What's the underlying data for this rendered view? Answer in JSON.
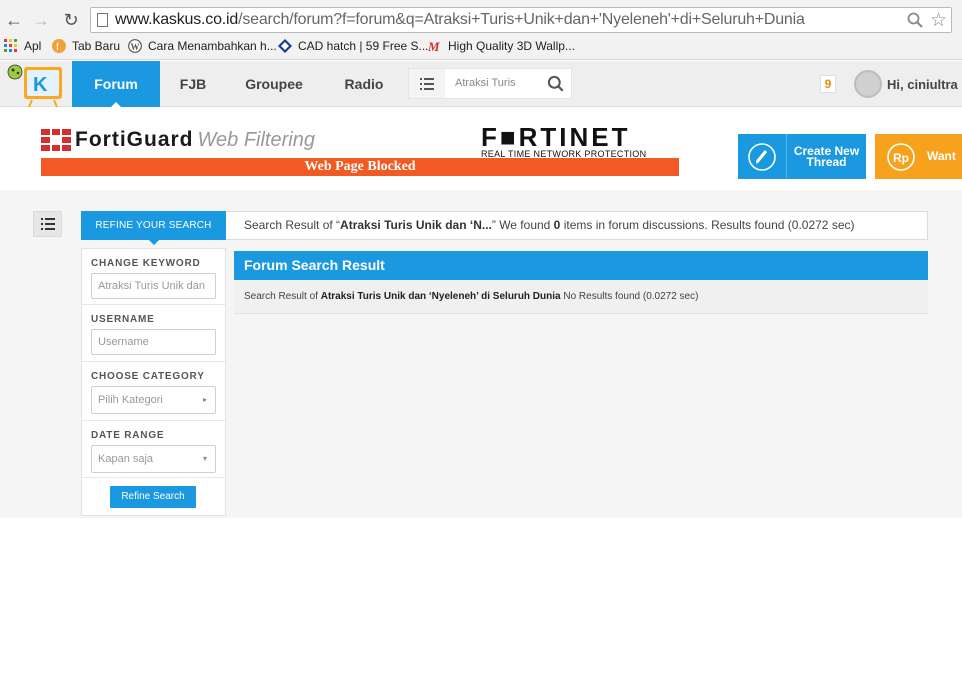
{
  "browser": {
    "url_host": "www.kaskus.co.id",
    "url_path": "/search/forum?f=forum&q=Atraksi+Turis+Unik+dan+'Nyeleneh'+di+Seluruh+Dunia",
    "bookmarks": [
      {
        "label": "Apl",
        "icon": "apps-icon"
      },
      {
        "label": "Tab Baru",
        "icon": "tab-icon"
      },
      {
        "label": "Cara Menambahkan h...",
        "icon": "wordpress-icon"
      },
      {
        "label": "CAD hatch | 59 Free S...",
        "icon": "cad-icon"
      },
      {
        "label": "High Quality 3D Wallp...",
        "icon": "gmail-icon"
      }
    ]
  },
  "header": {
    "nav": [
      "Forum",
      "FJB",
      "Groupee",
      "Radio"
    ],
    "active_nav": "Forum",
    "search_value": "Atraksi Turis",
    "notif_count": "9",
    "greeting": "Hi, ciniultra"
  },
  "banner": {
    "fortiguard": "FortiGuard",
    "web_filtering": "Web Filtering",
    "fortinet": "F■RTINET",
    "fortinet_sub": "REAL TIME NETWORK PROTECTION",
    "blocked": "Web Page Blocked"
  },
  "actions": {
    "create_thread": "Create New Thread",
    "want": "Want"
  },
  "refine": {
    "tab_label": "REFINE YOUR SEARCH",
    "summary_prefix": "Search Result of “",
    "summary_query": "Atraksi Turis Unik dan ‘N...",
    "summary_mid": "” We found ",
    "summary_count": "0",
    "summary_suffix": " items in forum discussions. Results found (0.0272 sec)"
  },
  "sidebar": {
    "keyword_label": "CHANGE KEYWORD",
    "keyword_value": "Atraksi Turis Unik dan",
    "username_label": "USERNAME",
    "username_placeholder": "Username",
    "category_label": "CHOOSE CATEGORY",
    "category_value": "Pilih Kategori",
    "date_label": "DATE RANGE",
    "date_value": "Kapan saja",
    "refine_button": "Refine Search"
  },
  "results": {
    "title": "Forum Search Result",
    "prefix": "Search Result of ",
    "query": "Atraksi Turis Unik dan ‘Nyeleneh’ di Seluruh Dunia",
    "suffix": " No Results found (0.0272 sec)"
  },
  "colors": {
    "kaskus_blue": "#1a98e0",
    "fortinet_orange": "#f15a22",
    "want_orange": "#f7a21c"
  }
}
